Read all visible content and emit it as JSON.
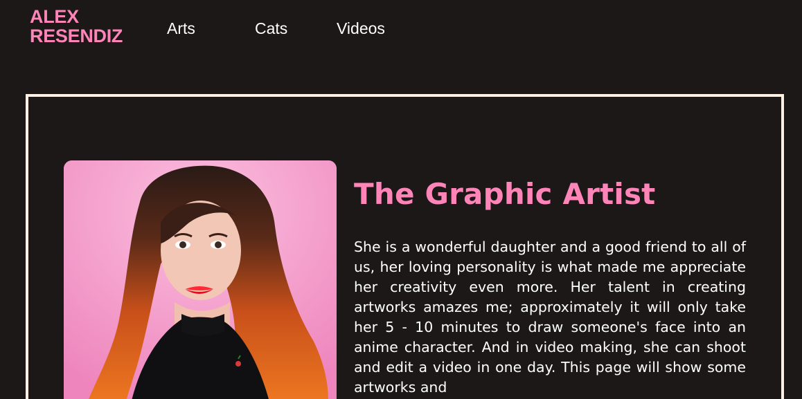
{
  "brand": {
    "line1": "ALEX",
    "line2": "RESENDIZ"
  },
  "nav": {
    "links": [
      {
        "label": "Arts"
      },
      {
        "label": "Cats"
      },
      {
        "label": "Videos"
      }
    ]
  },
  "hero": {
    "title": "The Graphic Artist",
    "bio": "She is a wonderful daughter and a good friend to all of us, her loving personality is what made me appreciate her creativity even more. Her talent in creating artworks amazes me; approximately it will only take her 5 - 10 minutes to draw someone's face into an anime character. And in video making, she can shoot and edit a video in one day. This page will show some artworks and"
  },
  "colors": {
    "background": "#1c1818",
    "accent_pink": "#ff85b8",
    "frame_border": "#fff1e6",
    "text": "#ffffff"
  }
}
